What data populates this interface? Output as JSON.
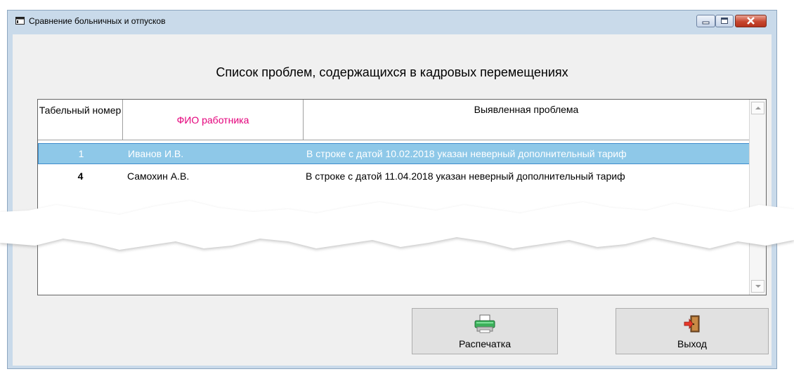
{
  "window": {
    "title": "Сравнение больничных и отпусков"
  },
  "heading": "Список проблем, содержащихся в кадровых перемещениях",
  "table": {
    "columns": [
      "Табельный номер",
      "ФИО работника",
      "Выявленная проблема"
    ],
    "rows": [
      {
        "number": "1",
        "name": "Иванов И.В.",
        "problem": "В строке с датой 10.02.2018 указан неверный дополнительный тариф",
        "selected": true
      },
      {
        "number": "4",
        "name": "Самохин А.В.",
        "problem": "В строке с датой 11.04.2018 указан неверный дополнительный тариф",
        "selected": false
      }
    ]
  },
  "buttons": {
    "print": {
      "label": "Распечатка",
      "icon": "printer-icon"
    },
    "exit": {
      "label": "Выход",
      "icon": "exit-door-icon"
    }
  },
  "colors": {
    "selected_row": "#8ec8e8",
    "name_header": "#e4007b",
    "close_button": "#c7472f"
  }
}
